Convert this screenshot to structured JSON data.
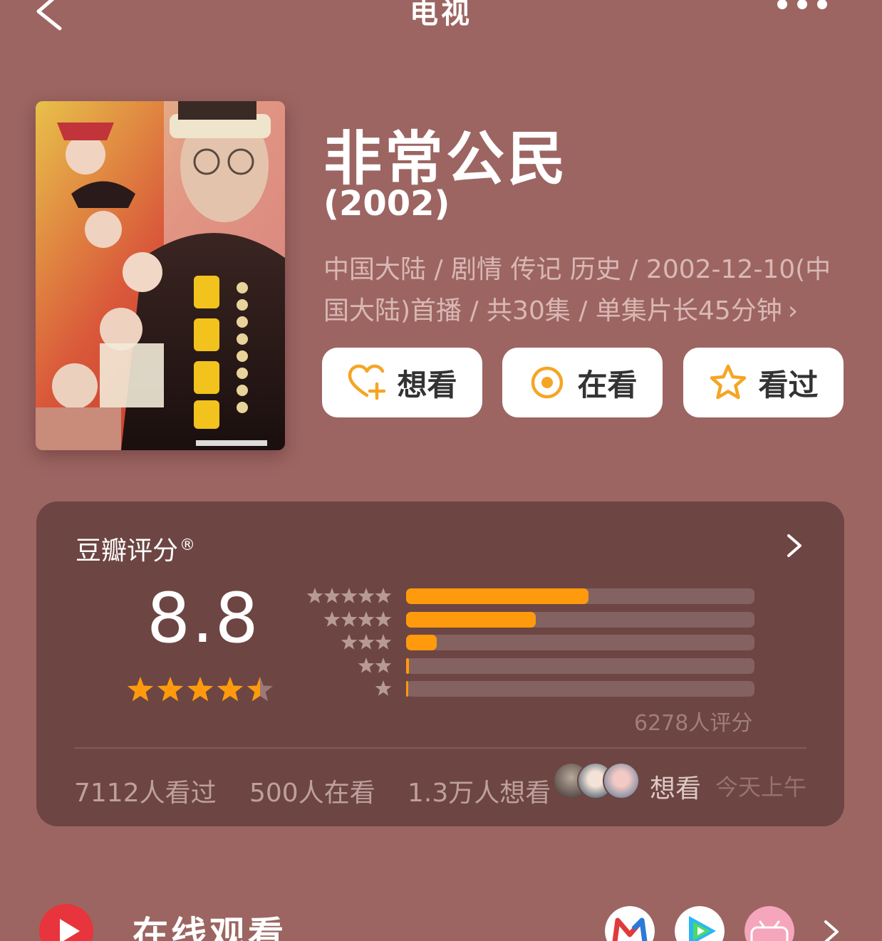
{
  "header": {
    "title": "电视",
    "back_icon": "chevron-left-icon",
    "more_icon": "more-dots-icon"
  },
  "movie": {
    "title": "非常公民",
    "year": "(2002)",
    "meta": "中国大陆 / 剧情 传记 历史 / 2002-12-10(中国大陆)首播 / 共30集 / 单集片长45分钟",
    "meta_arrow": "›"
  },
  "actions": {
    "want": "想看",
    "watching": "在看",
    "watched": "看过"
  },
  "rating": {
    "label": "豆瓣评分",
    "reg_mark": "®",
    "score": "8.8",
    "stars_value": 4.5,
    "distribution": [
      {
        "stars": 5,
        "fraction": 0.523
      },
      {
        "stars": 4,
        "fraction": 0.373
      },
      {
        "stars": 3,
        "fraction": 0.088
      },
      {
        "stars": 2,
        "fraction": 0.008
      },
      {
        "stars": 1,
        "fraction": 0.005
      }
    ],
    "count": "6278人评分"
  },
  "stats": {
    "watched": "7112人看过",
    "watching": "500人在看",
    "want": "1.3万人想看",
    "friend_action": "想看",
    "friend_time": "今天上午"
  },
  "online": {
    "title": "在线观看",
    "icon": "play-circle-icon",
    "platforms": [
      "mgtv-icon",
      "tencent-video-icon",
      "bilibili-icon"
    ]
  },
  "colors": {
    "background": "#9c6562",
    "card": "#6d4543",
    "accent": "#ff9a0d",
    "online_red": "#e8343c"
  }
}
